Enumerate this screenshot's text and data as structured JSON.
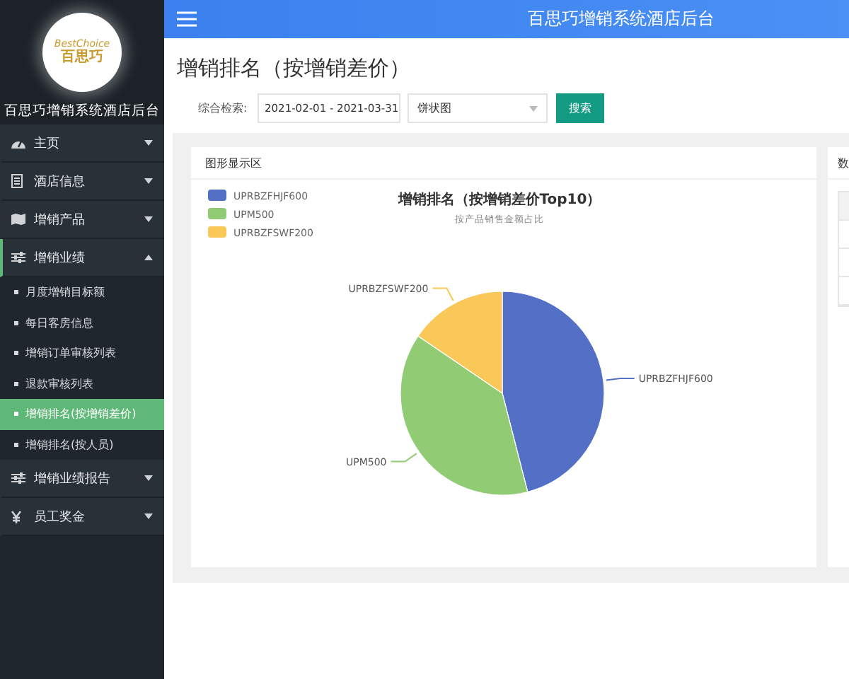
{
  "sidebar": {
    "logo": {
      "brand": "BestChoice",
      "name": "百思巧"
    },
    "title": "百思巧增销系统酒店后台",
    "items": [
      {
        "label": "主页",
        "expanded": false
      },
      {
        "label": "酒店信息",
        "expanded": false
      },
      {
        "label": "增销产品",
        "expanded": false
      },
      {
        "label": "增销业绩",
        "expanded": true,
        "children": [
          {
            "label": "月度增销目标额",
            "selected": false
          },
          {
            "label": "每日客房信息",
            "selected": false
          },
          {
            "label": "增销订单审核列表",
            "selected": false
          },
          {
            "label": "退款审核列表",
            "selected": false
          },
          {
            "label": "增销排名(按增销差价)",
            "selected": true
          },
          {
            "label": "增销排名(按人员)",
            "selected": false
          }
        ]
      },
      {
        "label": "增销业绩报告",
        "expanded": false
      },
      {
        "label": "员工奖金",
        "expanded": false
      }
    ]
  },
  "header": {
    "title": "百思巧增销系统酒店后台"
  },
  "page": {
    "title": "增销排名（按增销差价）",
    "search": {
      "label": "综合检索:",
      "date_range": "2021-02-01 - 2021-03-31",
      "chart_type": "饼状图",
      "button": "搜索"
    },
    "chart_card": {
      "title": "图形显示区",
      "chart_data": {
        "type": "pie",
        "title": "增销排名（按增销差价Top10）",
        "legend": "top-left",
        "categories": [
          "UPRBZFHJF600",
          "UPM500",
          "UPRBZFSWF200"
        ],
        "series": [
          {
            "name": "按产品销售金额占比",
            "values": [
              46,
              38.5,
              15.5
            ]
          }
        ],
        "colors": [
          "#5470c6",
          "#91cc75",
          "#fac858"
        ]
      }
    },
    "data_card": {
      "title": "数"
    }
  }
}
